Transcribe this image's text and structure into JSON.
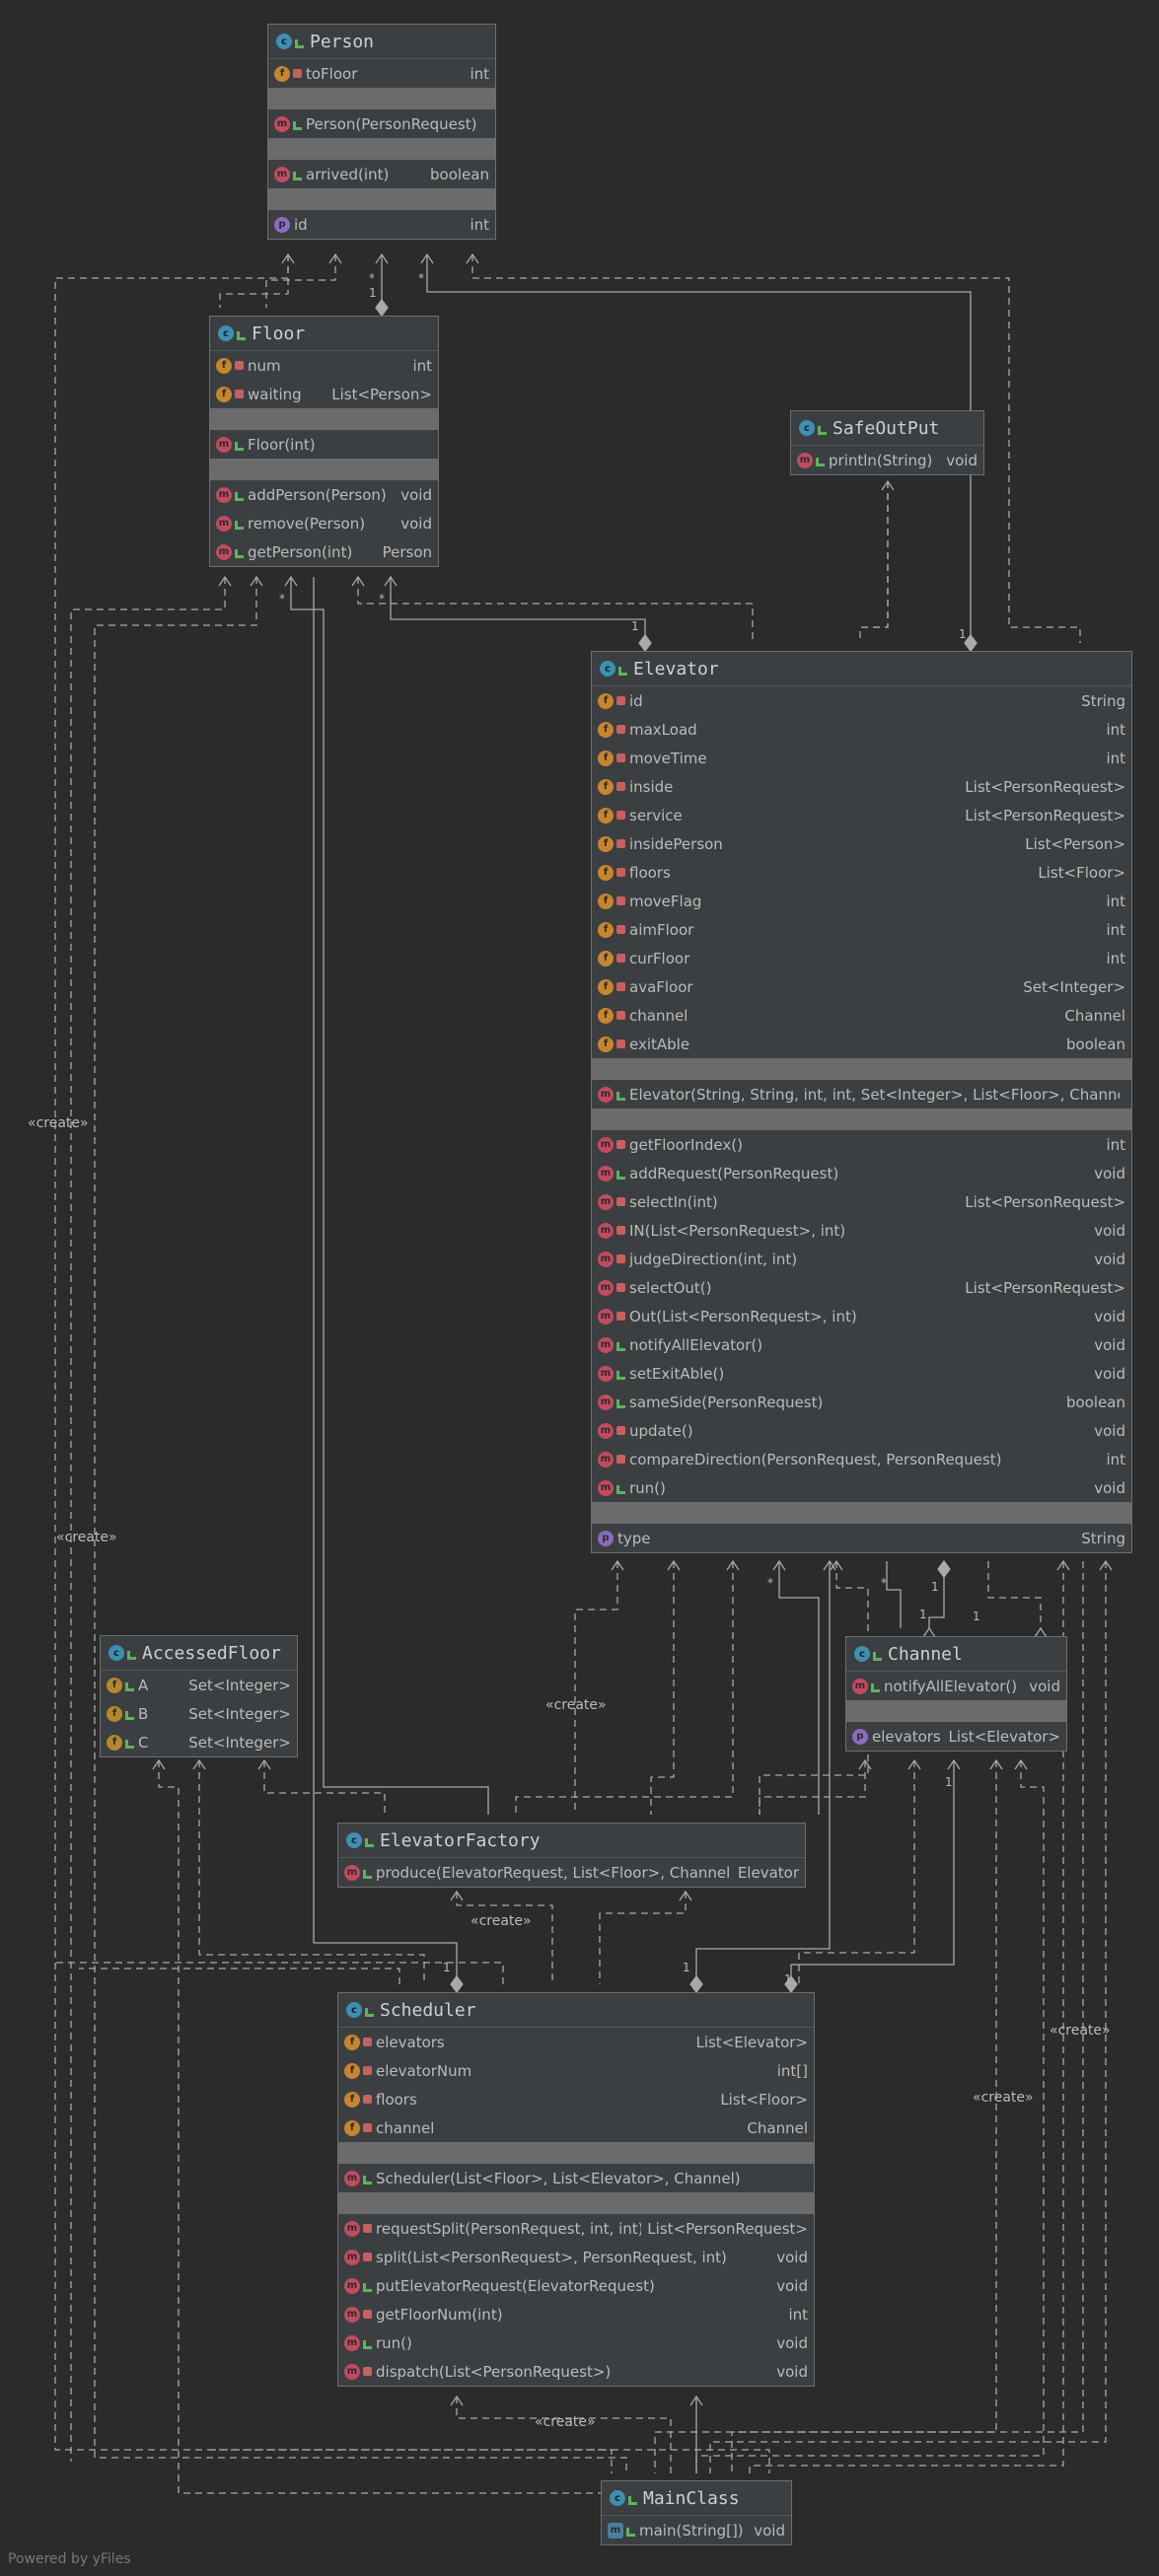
{
  "classes": {
    "person": {
      "name": "Person",
      "rows": [
        {
          "kind": "f",
          "vis": "priv",
          "name": "toFloor",
          "type": "int"
        },
        {
          "kind": "sep"
        },
        {
          "kind": "m",
          "vis": "pub",
          "name": "Person(PersonRequest)",
          "type": ""
        },
        {
          "kind": "sep"
        },
        {
          "kind": "m",
          "vis": "pub",
          "name": "arrived(int)",
          "type": "boolean"
        },
        {
          "kind": "sep"
        },
        {
          "kind": "p",
          "vis": "none",
          "name": "id",
          "type": "int"
        }
      ]
    },
    "floor": {
      "name": "Floor",
      "rows": [
        {
          "kind": "f",
          "vis": "priv",
          "name": "num",
          "type": "int"
        },
        {
          "kind": "f",
          "vis": "priv",
          "name": "waiting",
          "type": "List<Person>"
        },
        {
          "kind": "sep"
        },
        {
          "kind": "m",
          "vis": "pub",
          "name": "Floor(int)",
          "type": ""
        },
        {
          "kind": "sep"
        },
        {
          "kind": "m",
          "vis": "pub",
          "name": "addPerson(Person)",
          "type": "void"
        },
        {
          "kind": "m",
          "vis": "pub",
          "name": "remove(Person)",
          "type": "void"
        },
        {
          "kind": "m",
          "vis": "pub",
          "name": "getPerson(int)",
          "type": "Person"
        }
      ]
    },
    "safeoutput": {
      "name": "SafeOutPut",
      "rows": [
        {
          "kind": "m",
          "vis": "pub",
          "name": "println(String)",
          "type": "void"
        }
      ]
    },
    "elevator": {
      "name": "Elevator",
      "rows": [
        {
          "kind": "f",
          "vis": "priv",
          "name": "id",
          "type": "String"
        },
        {
          "kind": "f",
          "vis": "priv",
          "name": "maxLoad",
          "type": "int"
        },
        {
          "kind": "f",
          "vis": "priv",
          "name": "moveTime",
          "type": "int"
        },
        {
          "kind": "f",
          "vis": "priv",
          "name": "inside",
          "type": "List<PersonRequest>"
        },
        {
          "kind": "f",
          "vis": "priv",
          "name": "service",
          "type": "List<PersonRequest>"
        },
        {
          "kind": "f",
          "vis": "priv",
          "name": "insidePerson",
          "type": "List<Person>"
        },
        {
          "kind": "f",
          "vis": "priv",
          "name": "floors",
          "type": "List<Floor>"
        },
        {
          "kind": "f",
          "vis": "priv",
          "name": "moveFlag",
          "type": "int"
        },
        {
          "kind": "f",
          "vis": "priv",
          "name": "aimFloor",
          "type": "int"
        },
        {
          "kind": "f",
          "vis": "priv",
          "name": "curFloor",
          "type": "int"
        },
        {
          "kind": "f",
          "vis": "priv",
          "name": "avaFloor",
          "type": "Set<Integer>"
        },
        {
          "kind": "f",
          "vis": "priv",
          "name": "channel",
          "type": "Channel"
        },
        {
          "kind": "f",
          "vis": "priv",
          "name": "exitAble",
          "type": "boolean"
        },
        {
          "kind": "sep"
        },
        {
          "kind": "m",
          "vis": "pub",
          "name": "Elevator(String, String, int, int, Set<Integer>, List<Floor>, Channel)",
          "type": ""
        },
        {
          "kind": "sep"
        },
        {
          "kind": "m",
          "vis": "priv",
          "name": "getFloorIndex()",
          "type": "int"
        },
        {
          "kind": "m",
          "vis": "pub",
          "name": "addRequest(PersonRequest)",
          "type": "void"
        },
        {
          "kind": "m",
          "vis": "priv",
          "name": "selectIn(int)",
          "type": "List<PersonRequest>"
        },
        {
          "kind": "m",
          "vis": "priv",
          "name": "IN(List<PersonRequest>, int)",
          "type": "void"
        },
        {
          "kind": "m",
          "vis": "priv",
          "name": "judgeDirection(int, int)",
          "type": "void"
        },
        {
          "kind": "m",
          "vis": "priv",
          "name": "selectOut()",
          "type": "List<PersonRequest>"
        },
        {
          "kind": "m",
          "vis": "priv",
          "name": "Out(List<PersonRequest>, int)",
          "type": "void"
        },
        {
          "kind": "m",
          "vis": "pub",
          "name": "notifyAllElevator()",
          "type": "void"
        },
        {
          "kind": "m",
          "vis": "pub",
          "name": "setExitAble()",
          "type": "void"
        },
        {
          "kind": "m",
          "vis": "pub",
          "name": "sameSide(PersonRequest)",
          "type": "boolean"
        },
        {
          "kind": "m",
          "vis": "priv",
          "name": "update()",
          "type": "void"
        },
        {
          "kind": "m",
          "vis": "priv",
          "name": "compareDirection(PersonRequest, PersonRequest)",
          "type": "int"
        },
        {
          "kind": "m",
          "vis": "pub",
          "name": "run()",
          "type": "void"
        },
        {
          "kind": "sep"
        },
        {
          "kind": "p",
          "vis": "none",
          "name": "type",
          "type": "String"
        }
      ]
    },
    "accessedfloor": {
      "name": "AccessedFloor",
      "rows": [
        {
          "kind": "e",
          "vis": "pub",
          "name": "A",
          "type": "Set<Integer>"
        },
        {
          "kind": "e",
          "vis": "pub",
          "name": "B",
          "type": "Set<Integer>"
        },
        {
          "kind": "e",
          "vis": "pub",
          "name": "C",
          "type": "Set<Integer>"
        }
      ]
    },
    "channel": {
      "name": "Channel",
      "rows": [
        {
          "kind": "m",
          "vis": "pub",
          "name": "notifyAllElevator()",
          "type": "void"
        },
        {
          "kind": "sep"
        },
        {
          "kind": "p",
          "vis": "none",
          "name": "elevators",
          "type": "List<Elevator>"
        }
      ]
    },
    "elevatorfactory": {
      "name": "ElevatorFactory",
      "rows": [
        {
          "kind": "m",
          "vis": "pub",
          "name": "produce(ElevatorRequest, List<Floor>, Channel)",
          "type": "Elevator"
        }
      ]
    },
    "scheduler": {
      "name": "Scheduler",
      "rows": [
        {
          "kind": "f",
          "vis": "priv",
          "name": "elevators",
          "type": "List<Elevator>"
        },
        {
          "kind": "f",
          "vis": "priv",
          "name": "elevatorNum",
          "type": "int[]"
        },
        {
          "kind": "f",
          "vis": "priv",
          "name": "floors",
          "type": "List<Floor>"
        },
        {
          "kind": "f",
          "vis": "priv",
          "name": "channel",
          "type": "Channel"
        },
        {
          "kind": "sep"
        },
        {
          "kind": "m",
          "vis": "pub",
          "name": "Scheduler(List<Floor>, List<Elevator>, Channel)",
          "type": ""
        },
        {
          "kind": "sep"
        },
        {
          "kind": "m",
          "vis": "priv",
          "name": "requestSplit(PersonRequest, int, int)",
          "type": "List<PersonRequest>"
        },
        {
          "kind": "m",
          "vis": "priv",
          "name": "split(List<PersonRequest>, PersonRequest, int)",
          "type": "void"
        },
        {
          "kind": "m",
          "vis": "pub",
          "name": "putElevatorRequest(ElevatorRequest)",
          "type": "void"
        },
        {
          "kind": "m",
          "vis": "priv",
          "name": "getFloorNum(int)",
          "type": "int"
        },
        {
          "kind": "m",
          "vis": "pub",
          "name": "run()",
          "type": "void"
        },
        {
          "kind": "m",
          "vis": "priv",
          "name": "dispatch(List<PersonRequest>)",
          "type": "void"
        }
      ]
    },
    "mainclass": {
      "name": "MainClass",
      "rows": [
        {
          "kind": "main",
          "vis": "pub",
          "name": "main(String[])",
          "type": "void"
        }
      ]
    }
  },
  "labels": {
    "create": "«create»",
    "star": "*",
    "one": "1"
  },
  "powered_by": "Powered by yFiles",
  "colors": {
    "background": "#2b2b2b",
    "node_fill": "#3c3f41",
    "separator": "#6b6b6b",
    "edge": "#a9a9a9",
    "class_icon": "#3d8fb3",
    "field_icon": "#c7852e",
    "method_icon": "#c24b5f",
    "property_icon": "#8a6bbd"
  }
}
